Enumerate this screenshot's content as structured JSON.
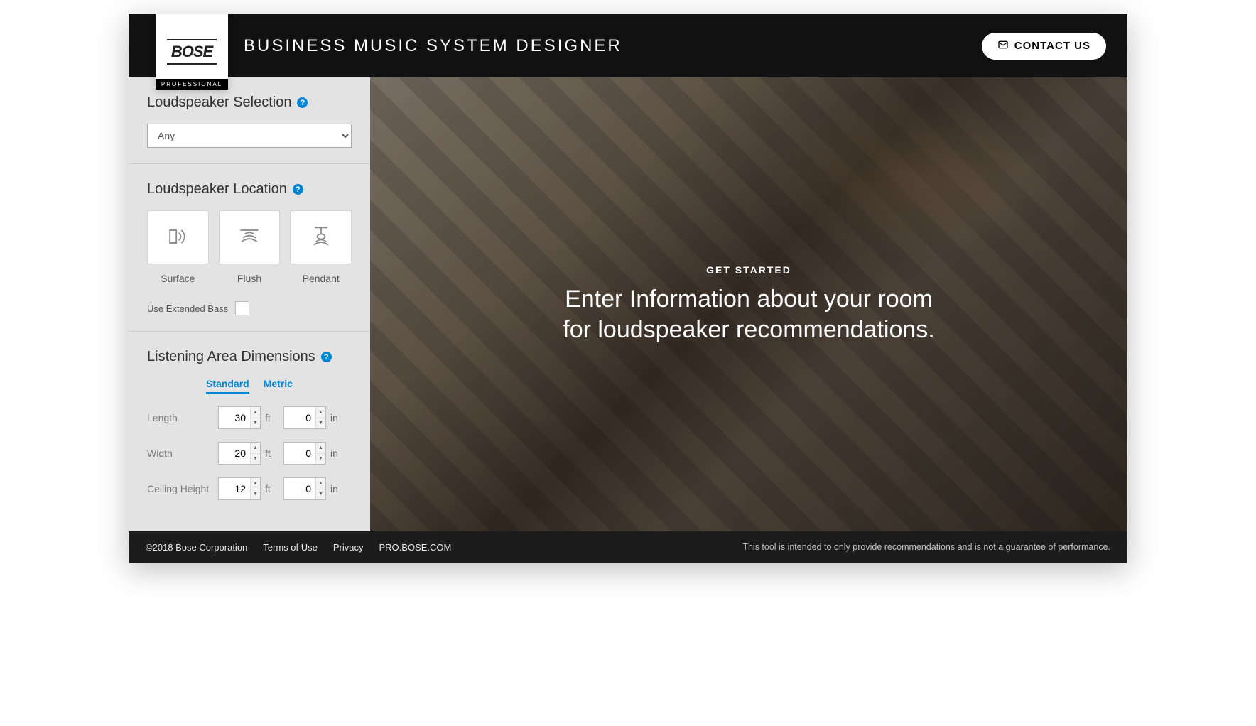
{
  "header": {
    "brand": "BOSE",
    "brand_sub": "PROFESSIONAL",
    "title": "BUSINESS MUSIC SYSTEM DESIGNER",
    "contact_label": "CONTACT US"
  },
  "sidebar": {
    "selection": {
      "title": "Loudspeaker Selection",
      "dropdown_value": "Any"
    },
    "location": {
      "title": "Loudspeaker Location",
      "options": [
        {
          "label": "Surface"
        },
        {
          "label": "Flush"
        },
        {
          "label": "Pendant"
        }
      ],
      "extended_bass_label": "Use Extended Bass"
    },
    "dimensions": {
      "title": "Listening Area Dimensions",
      "tabs": {
        "standard": "Standard",
        "metric": "Metric",
        "active": "standard"
      },
      "rows": [
        {
          "label": "Length",
          "ft": "30",
          "in": "0"
        },
        {
          "label": "Width",
          "ft": "20",
          "in": "0"
        },
        {
          "label": "Ceiling Height",
          "ft": "12",
          "in": "0"
        }
      ],
      "unit_ft": "ft",
      "unit_in": "in"
    }
  },
  "hero": {
    "kicker": "GET STARTED",
    "line1": "Enter Information about your room",
    "line2": "for loudspeaker recommendations."
  },
  "footer": {
    "copyright": "©2018 Bose Corporation",
    "links": [
      "Terms of Use",
      "Privacy",
      "PRO.BOSE.COM"
    ],
    "disclaimer": "This tool is intended to only provide recommendations and is not a guarantee of performance."
  }
}
